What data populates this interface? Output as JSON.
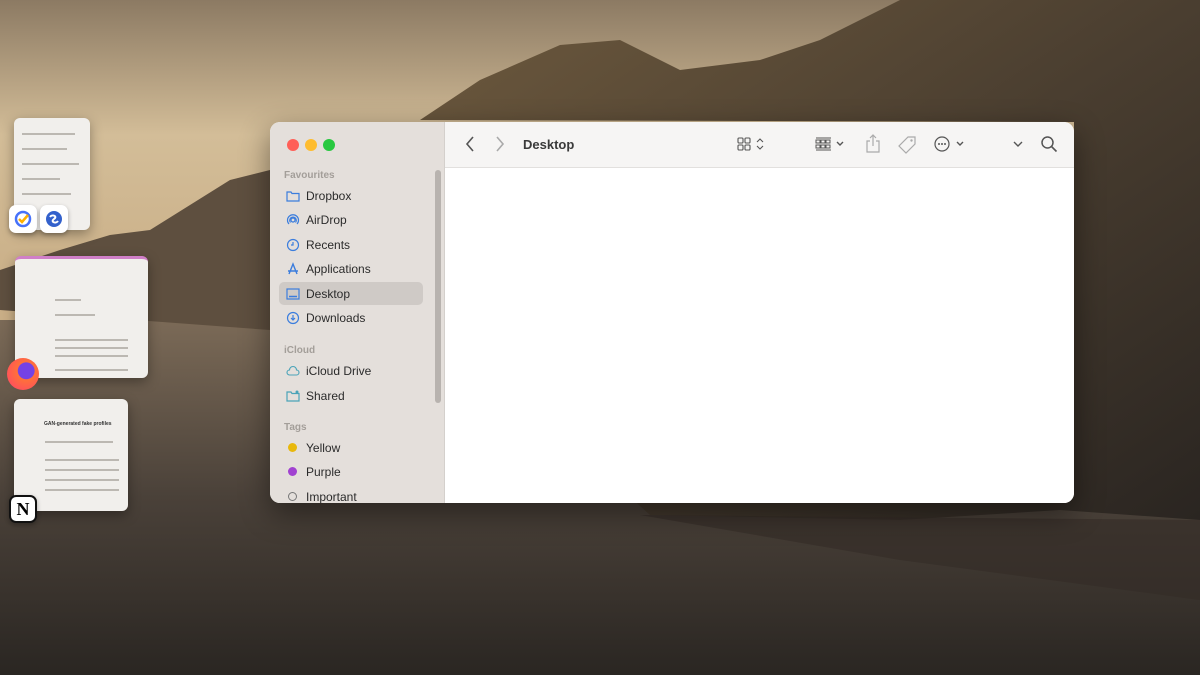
{
  "finder": {
    "title": "Desktop",
    "sidebar": {
      "sections": [
        {
          "label": "Favourites",
          "items": [
            {
              "label": "Dropbox",
              "icon": "folder-icon"
            },
            {
              "label": "AirDrop",
              "icon": "airdrop-icon"
            },
            {
              "label": "Recents",
              "icon": "clock-icon"
            },
            {
              "label": "Applications",
              "icon": "applications-icon"
            },
            {
              "label": "Desktop",
              "icon": "desktop-icon",
              "selected": true
            },
            {
              "label": "Downloads",
              "icon": "download-icon"
            }
          ]
        },
        {
          "label": "iCloud",
          "items": [
            {
              "label": "iCloud Drive",
              "icon": "cloud-icon"
            },
            {
              "label": "Shared",
              "icon": "shared-folder-icon"
            }
          ]
        },
        {
          "label": "Tags",
          "items": [
            {
              "label": "Yellow",
              "color": "#e8b80c"
            },
            {
              "label": "Purple",
              "color": "#a142d1"
            },
            {
              "label": "Important",
              "color": "none"
            }
          ]
        }
      ]
    },
    "toolbar_icons": [
      "back-icon",
      "forward-icon",
      "grid-view-icon",
      "group-icon",
      "share-icon",
      "tag-icon",
      "more-icon",
      "chevron-down-icon",
      "search-icon"
    ]
  },
  "stage_manager": {
    "windows": [
      {
        "app": "TickTick / Simplenote"
      },
      {
        "app": "Firefox"
      },
      {
        "app": "Notion",
        "doc_title": "GAN-generated fake profiles"
      }
    ]
  },
  "colors": {
    "accent": "#3b7ddd",
    "close": "#ff5f57",
    "minimize": "#febc2e",
    "zoom": "#28c840"
  }
}
